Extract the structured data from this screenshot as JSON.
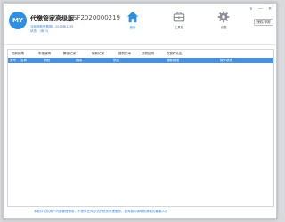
{
  "header": {
    "logo_text": "MY",
    "app_title": "代缴管家高级版",
    "app_code": "SF2020000219",
    "period_line": "当前税款所属期：2019年12月",
    "state_line": "状态：(申 0)"
  },
  "nav": [
    {
      "label": "首页",
      "icon": "home-icon"
    },
    {
      "label": "工具箱",
      "icon": "toolbox-icon"
    },
    {
      "label": "设置",
      "icon": "gear-icon"
    }
  ],
  "window_controls": {
    "dropdown": "∨",
    "minimize": "—",
    "close": "✕"
  },
  "apply_button": "授权/申报",
  "tabs": [
    "税款缴纳",
    "申报缴纳",
    "解缴记录",
    "缴款记录",
    "缴税记录",
    "完税证明",
    "税费种认定"
  ],
  "table": {
    "columns": [
      "序号",
      "名称",
      "纳税",
      "期限",
      "状态",
      "缴款期限",
      "操作状态"
    ]
  },
  "footer_note": "本软件仅供用户内部管理使用，不提供任何形式的税务代理服务，如有疑问请联系我们的客服人员",
  "colors": {
    "accent": "#2f8fe0",
    "table_header": "#4a90e2",
    "note_text": "#3a7fd0"
  }
}
